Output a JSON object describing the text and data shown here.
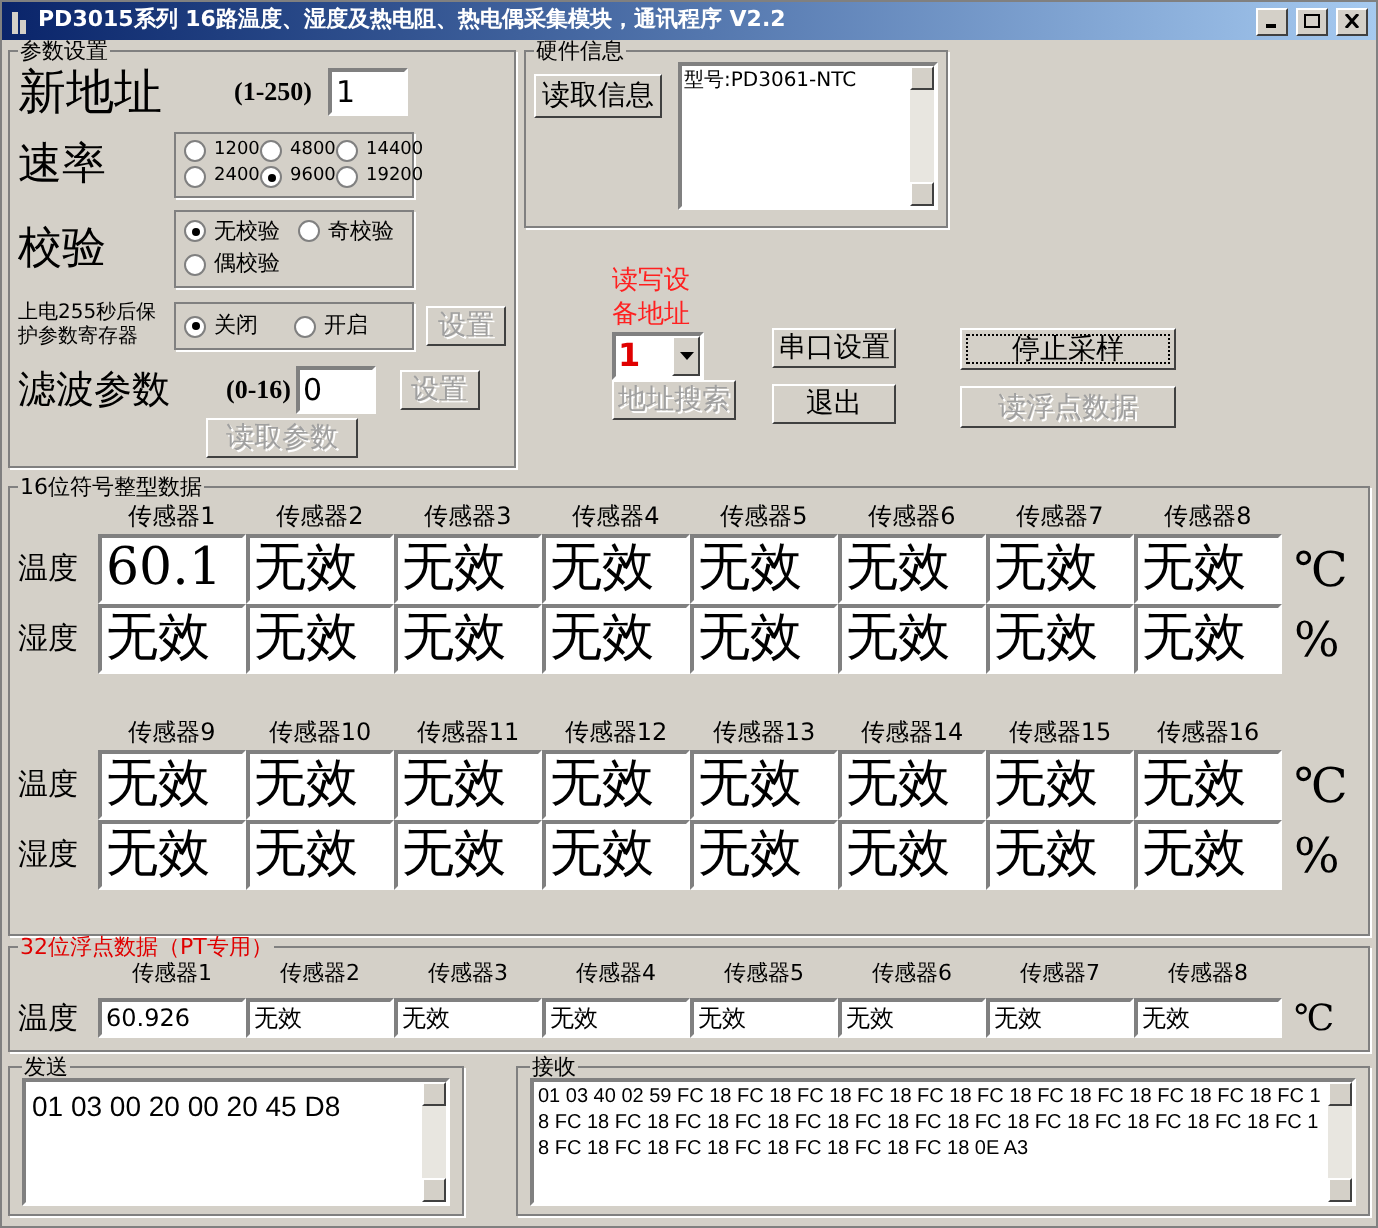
{
  "window": {
    "title": "PD3015系列 16路温度、湿度及热电阻、热电偶采集模块，通讯程序 V2.2"
  },
  "params": {
    "title": "参数设置",
    "address": {
      "label": "新地址",
      "range": "(1-250)",
      "value": "1"
    },
    "baud": {
      "label": "速率",
      "options": [
        {
          "label": "1200",
          "selected": false
        },
        {
          "label": "4800",
          "selected": false
        },
        {
          "label": "14400",
          "selected": false
        },
        {
          "label": "2400",
          "selected": false
        },
        {
          "label": "9600",
          "selected": true
        },
        {
          "label": "19200",
          "selected": false
        }
      ]
    },
    "parity": {
      "label": "校验",
      "options": [
        {
          "label": "无校验",
          "selected": true
        },
        {
          "label": "奇校验",
          "selected": false
        },
        {
          "label": "偶校验",
          "selected": false
        }
      ]
    },
    "protect": {
      "label": "上电255秒后保护参数寄存器",
      "options": [
        {
          "label": "关闭",
          "selected": true
        },
        {
          "label": "开启",
          "selected": false
        }
      ],
      "button": {
        "label": "设置",
        "disabled": true
      }
    },
    "filter": {
      "label": "滤波参数",
      "range": "(0-16)",
      "value": "0",
      "button": {
        "label": "设置",
        "disabled": true
      }
    },
    "read_button": {
      "label": "读取参数",
      "disabled": true
    }
  },
  "hardware": {
    "title": "硬件信息",
    "button": {
      "label": "读取信息",
      "disabled": false
    },
    "info": "型号:PD3061-NTC"
  },
  "device_address": {
    "label": "读写设备地址",
    "value": "1",
    "search_button": {
      "label": "地址搜索",
      "disabled": true
    }
  },
  "actions": [
    {
      "label": "串口设置",
      "disabled": false,
      "focused": false
    },
    {
      "label": "退出",
      "disabled": false,
      "focused": false
    },
    {
      "label": "停止采样",
      "disabled": false,
      "focused": true
    },
    {
      "label": "读浮点数据",
      "disabled": true,
      "focused": false
    }
  ],
  "int_group": {
    "title": "16位符号整型数据",
    "blocks": [
      {
        "headers": [
          "传感器1",
          "传感器2",
          "传感器3",
          "传感器4",
          "传感器5",
          "传感器6",
          "传感器7",
          "传感器8"
        ],
        "rows": [
          {
            "label": "温度",
            "unit": "℃",
            "values": [
              "60.1",
              "无效",
              "无效",
              "无效",
              "无效",
              "无效",
              "无效",
              "无效"
            ]
          },
          {
            "label": "湿度",
            "unit": "%",
            "values": [
              "无效",
              "无效",
              "无效",
              "无效",
              "无效",
              "无效",
              "无效",
              "无效"
            ]
          }
        ]
      },
      {
        "headers": [
          "传感器9",
          "传感器10",
          "传感器11",
          "传感器12",
          "传感器13",
          "传感器14",
          "传感器15",
          "传感器16"
        ],
        "rows": [
          {
            "label": "温度",
            "unit": "℃",
            "values": [
              "无效",
              "无效",
              "无效",
              "无效",
              "无效",
              "无效",
              "无效",
              "无效"
            ]
          },
          {
            "label": "湿度",
            "unit": "%",
            "values": [
              "无效",
              "无效",
              "无效",
              "无效",
              "无效",
              "无效",
              "无效",
              "无效"
            ]
          }
        ]
      }
    ]
  },
  "float_group": {
    "title": "32位浮点数据（PT专用）",
    "headers": [
      "传感器1",
      "传感器2",
      "传感器3",
      "传感器4",
      "传感器5",
      "传感器6",
      "传感器7",
      "传感器8"
    ],
    "row": {
      "label": "温度",
      "unit": "℃",
      "values": [
        "60.926",
        "无效",
        "无效",
        "无效",
        "无效",
        "无效",
        "无效",
        "无效"
      ]
    }
  },
  "send": {
    "title": "发送",
    "value": "01 03 00 20 00 20 45 D8"
  },
  "receive": {
    "title": "接收",
    "value": "01 03 40 02 59 FC 18 FC 18 FC 18 FC 18 FC 18 FC 18 FC 18 FC 18 FC 18 FC 18 FC 18 FC 18 FC 18 FC 18 FC 18 FC 18 FC 18 FC 18 FC 18 FC 18 FC 18 FC 18 FC 18 FC 18 FC 18 FC 18 FC 18 FC 18 FC 18 FC 18 FC 18 0E A3"
  }
}
